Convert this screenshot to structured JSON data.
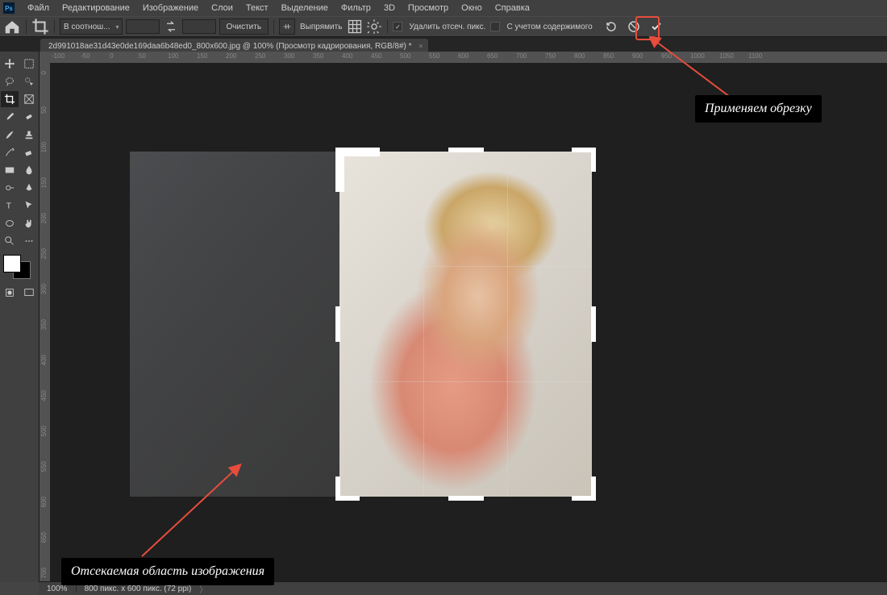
{
  "menu": [
    "Файл",
    "Редактирование",
    "Изображение",
    "Слои",
    "Текст",
    "Выделение",
    "Фильтр",
    "3D",
    "Просмотр",
    "Окно",
    "Справка"
  ],
  "options": {
    "ratio_select": "В соотнош...",
    "clear": "Очистить",
    "straighten": "Выпрямить",
    "delete_pixels_checked": true,
    "delete_pixels_label": "Удалить отсеч. пикс.",
    "content_aware_checked": false,
    "content_aware_label": "С учетом содержимого"
  },
  "tab": {
    "title": "2d991018ae31d43e0de169daa6b48ed0_800x600.jpg @ 100% (Просмотр кадрирования, RGB/8#) *"
  },
  "ruler_h": [
    -100,
    -50,
    0,
    50,
    100,
    150,
    200,
    250,
    300,
    350,
    400,
    450,
    500,
    550,
    600,
    650,
    700,
    750,
    800,
    850,
    900,
    950,
    1000,
    1050,
    1100
  ],
  "ruler_v": [
    0,
    50,
    100,
    150,
    200,
    250,
    300,
    350,
    400,
    450,
    500,
    550,
    600,
    650,
    700
  ],
  "status": {
    "zoom": "100%",
    "doc": "800 пикс. x 600 пикс. (72 ppi)"
  },
  "annotations": {
    "apply": "Применяем обрезку",
    "cropped_out": "Отсекаемая область изображения"
  }
}
